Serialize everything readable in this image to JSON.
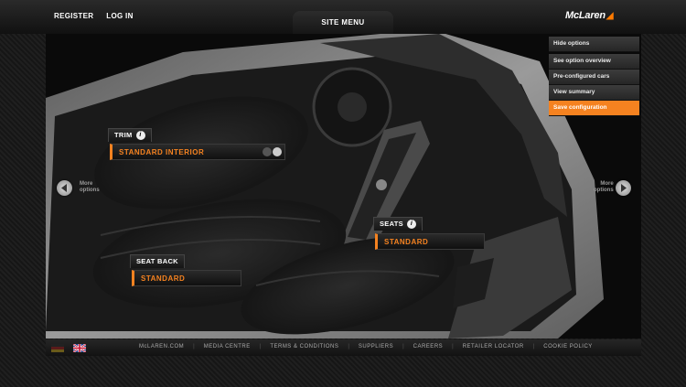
{
  "header": {
    "links": [
      "REGISTER",
      "LOG IN"
    ],
    "site_menu": "SITE MENU",
    "logo_text": "McLaren"
  },
  "options_panel": {
    "hide": "Hide options",
    "items": [
      "See option overview",
      "Pre-configured cars",
      "View summary"
    ],
    "save": "Save configuration"
  },
  "trim": {
    "label": "TRIM",
    "value": "STANDARD INTERIOR"
  },
  "seats": {
    "label": "SEATS",
    "value": "STANDARD"
  },
  "seat_back": {
    "label": "SEAT BACK",
    "value": "STANDARD"
  },
  "info_glyph": "i",
  "nav": {
    "left": "More\noptions",
    "right": "More\noptions"
  },
  "footer": {
    "links": [
      "McLAREN.COM",
      "MEDIA CENTRE",
      "TERMS & CONDITIONS",
      "SUPPLIERS",
      "CAREERS",
      "RETAILER LOCATOR",
      "COOKIE POLICY"
    ]
  },
  "colors": {
    "accent": "#f58220",
    "background": "#1a1a1a",
    "text": "#ffffff"
  }
}
